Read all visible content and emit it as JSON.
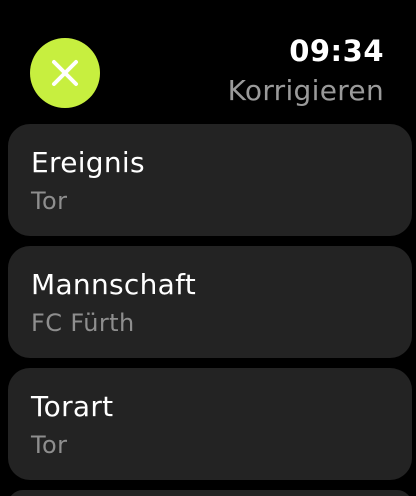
{
  "header": {
    "time": "09:34",
    "title": "Korrigieren",
    "close_icon": "close-icon",
    "accent_color": "#c7ef3f"
  },
  "list": {
    "items": [
      {
        "label": "Ereignis",
        "value": "Tor"
      },
      {
        "label": "Mannschaft",
        "value": "FC Fürth"
      },
      {
        "label": "Torart",
        "value": "Tor"
      }
    ]
  }
}
